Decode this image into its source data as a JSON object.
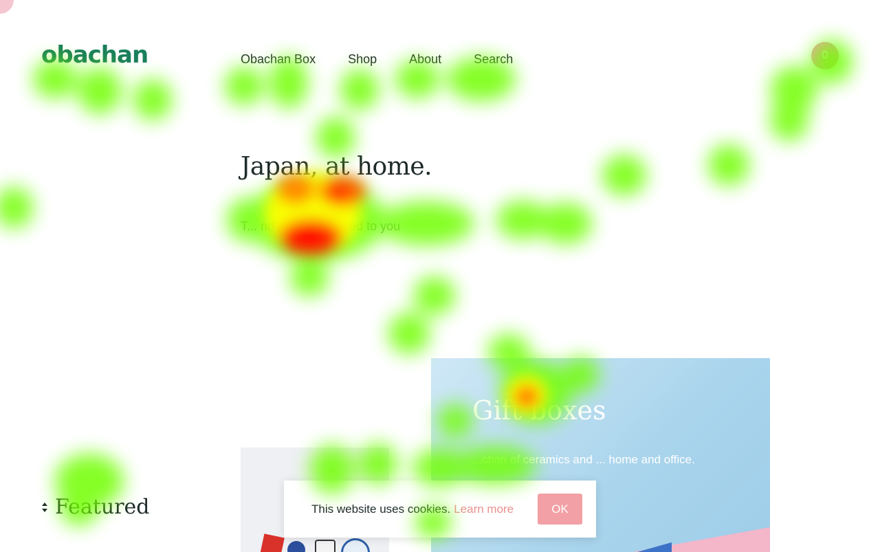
{
  "header": {
    "logo": "obachan",
    "nav": [
      "Obachan Box",
      "Shop",
      "About",
      "Search"
    ],
    "cart_count": "0"
  },
  "hero": {
    "title": "Japan, at home.",
    "subtitle": "T... nd-picked a... ered to you"
  },
  "cards": {
    "right": {
      "title": "Gift boxes",
      "text": "...ction of ceramics and ... home and office."
    }
  },
  "featured": {
    "label": "Featured"
  },
  "cookie_banner": {
    "text": "This website uses cookies.",
    "link": "Learn more",
    "button": "OK"
  },
  "colors": {
    "accent_pink": "#f2a0a5",
    "logo_green": "#1aa36a",
    "logo_blue": "#1762a8"
  }
}
